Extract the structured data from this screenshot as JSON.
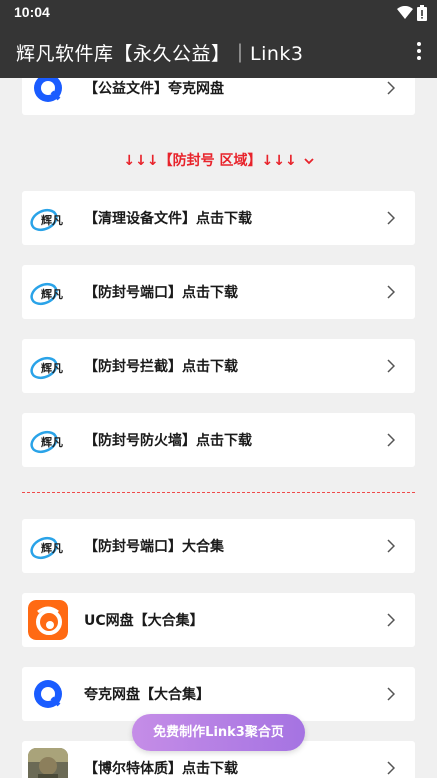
{
  "status": {
    "time": "10:04"
  },
  "appbar": {
    "title": "辉凡软件库【永久公益】｜Link3"
  },
  "cards_top": [
    {
      "label": "【公益文件】夸克网盘",
      "icon": "quark-logo-icon"
    }
  ],
  "section_title": "↓↓↓【防封号 区域】↓↓↓",
  "section_cards": [
    {
      "label": "【清理设备文件】点击下载",
      "icon": "huifan-logo-icon"
    },
    {
      "label": "【防封号端口】点击下载",
      "icon": "huifan-logo-icon"
    },
    {
      "label": "【防封号拦截】点击下载",
      "icon": "huifan-logo-icon"
    },
    {
      "label": "【防封号防火墙】点击下载",
      "icon": "huifan-logo-icon"
    }
  ],
  "bottom_cards": [
    {
      "label": "【防封号端口】大合集",
      "icon": "huifan-logo-icon"
    },
    {
      "label": "UC网盘【大合集】",
      "icon": "uc-logo-icon"
    },
    {
      "label": "夸克网盘【大合集】",
      "icon": "quark-logo-icon"
    },
    {
      "label": "【博尔特体质】点击下载",
      "icon": "game-avatar-icon"
    }
  ],
  "logo_text": "辉凡",
  "fab": {
    "label": "免费制作Link3聚合页"
  },
  "colors": {
    "appbar": "#353535",
    "accent_red": "#e8232b",
    "fab_start": "#c58de7",
    "fab_end": "#a573e2"
  }
}
